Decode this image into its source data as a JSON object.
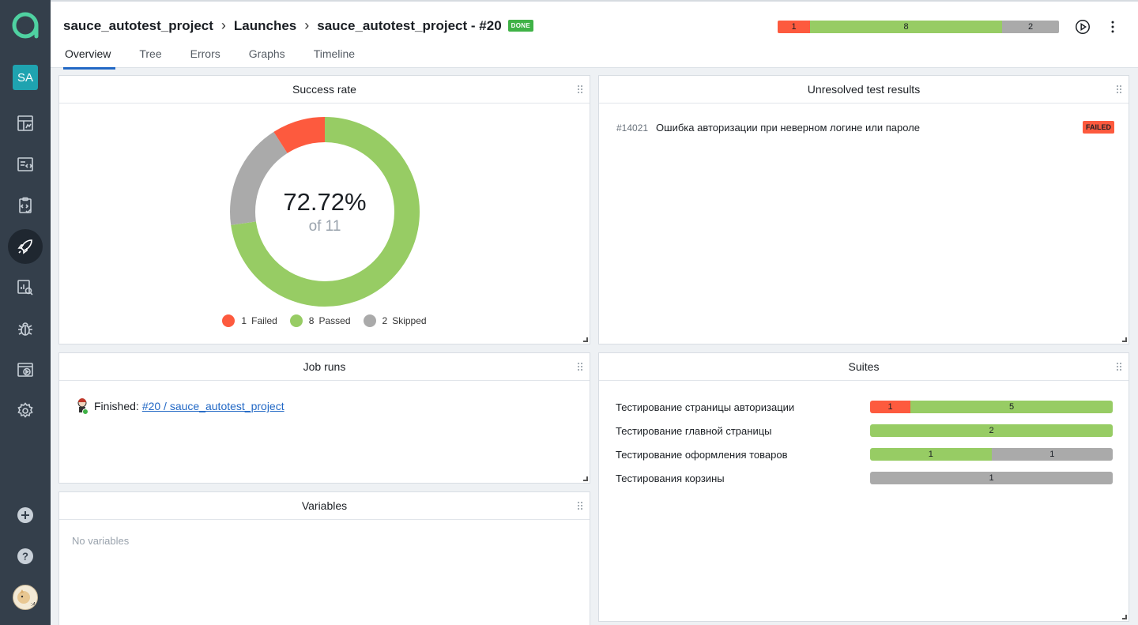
{
  "sidebar": {
    "project_badge": "SA",
    "items": [
      {
        "name": "dashboards",
        "icon": "dashboard-icon"
      },
      {
        "name": "test-cases",
        "icon": "test-cases-icon"
      },
      {
        "name": "test-plans",
        "icon": "test-plans-icon"
      },
      {
        "name": "launches",
        "icon": "rocket-icon",
        "active": true
      },
      {
        "name": "analytics",
        "icon": "analytics-icon"
      },
      {
        "name": "defects",
        "icon": "bug-icon"
      },
      {
        "name": "jobs",
        "icon": "jobs-icon"
      },
      {
        "name": "settings",
        "icon": "gear-icon"
      }
    ],
    "bottom": [
      "plus-circle-icon",
      "help-icon"
    ]
  },
  "header": {
    "breadcrumb": [
      "sauce_autotest_project",
      "Launches",
      "sauce_autotest_project - #20"
    ],
    "status_badge": "DONE",
    "tabs": [
      {
        "label": "Overview",
        "active": true
      },
      {
        "label": "Tree"
      },
      {
        "label": "Errors"
      },
      {
        "label": "Graphs"
      },
      {
        "label": "Timeline"
      }
    ],
    "stats": {
      "failed": "1",
      "passed": "8",
      "skipped": "2"
    }
  },
  "colors": {
    "failed": "#fd5a3e",
    "passed": "#97cc64",
    "skipped": "#aaaaaa",
    "accent": "#2268c5"
  },
  "widgets": {
    "success_rate": {
      "title": "Success rate",
      "percent": "72.72%",
      "of": "of 11",
      "legend": [
        {
          "count": "1",
          "label": "Failed"
        },
        {
          "count": "8",
          "label": "Passed"
        },
        {
          "count": "2",
          "label": "Skipped"
        }
      ]
    },
    "unresolved": {
      "title": "Unresolved test results",
      "rows": [
        {
          "id": "#14021",
          "name": "Ошибка авторизации при неверном логине или пароле",
          "status": "FAILED"
        }
      ]
    },
    "job_runs": {
      "title": "Job runs",
      "label": "Finished:",
      "link": "#20 / sauce_autotest_project"
    },
    "variables": {
      "title": "Variables",
      "empty": "No variables"
    },
    "suites": {
      "title": "Suites",
      "rows": [
        {
          "name": "Тестирование страницы авторизации",
          "failed": 1,
          "passed": 5,
          "skipped": 0
        },
        {
          "name": "Тестирование главной страницы",
          "failed": 0,
          "passed": 2,
          "skipped": 0
        },
        {
          "name": "Тестирование оформления товаров",
          "failed": 0,
          "passed": 1,
          "skipped": 1
        },
        {
          "name": "Тестирования корзины",
          "failed": 0,
          "passed": 0,
          "skipped": 1
        }
      ]
    }
  },
  "chart_data": {
    "type": "pie",
    "title": "Success rate",
    "categories": [
      "Failed",
      "Passed",
      "Skipped"
    ],
    "values": [
      1,
      8,
      2
    ],
    "colors": [
      "#fd5a3e",
      "#97cc64",
      "#aaaaaa"
    ]
  }
}
